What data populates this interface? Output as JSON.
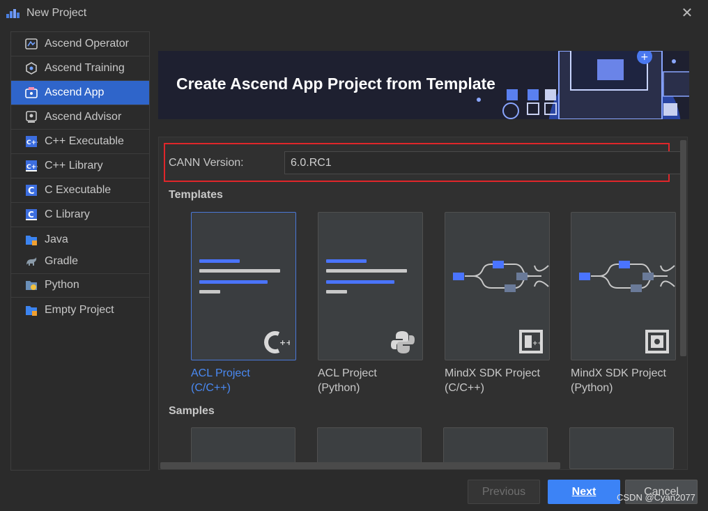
{
  "window": {
    "title": "New Project",
    "close_icon": "close-icon"
  },
  "sidebar": {
    "items": [
      {
        "label": "Ascend Operator",
        "icon": "ascend-operator-icon"
      },
      {
        "label": "Ascend Training",
        "icon": "ascend-training-icon"
      },
      {
        "label": "Ascend App",
        "icon": "ascend-app-icon",
        "active": true
      },
      {
        "label": "Ascend Advisor",
        "icon": "ascend-advisor-icon"
      },
      {
        "label": "C++ Executable",
        "icon": "cpp-executable-icon"
      },
      {
        "label": "C++ Library",
        "icon": "cpp-library-icon"
      },
      {
        "label": "C Executable",
        "icon": "c-executable-icon"
      },
      {
        "label": "C Library",
        "icon": "c-library-icon"
      },
      {
        "label": "Java",
        "icon": "java-folder-icon"
      },
      {
        "label": "Gradle",
        "icon": "gradle-elephant-icon"
      },
      {
        "label": "Python",
        "icon": "python-folder-icon"
      },
      {
        "label": "Empty Project",
        "icon": "empty-project-folder-icon"
      }
    ]
  },
  "banner": {
    "title": "Create Ascend App Project from Template"
  },
  "cann": {
    "label": "CANN Version:",
    "value": "6.0.RC1"
  },
  "templates": {
    "heading": "Templates",
    "items": [
      {
        "label_line1": "ACL Project",
        "label_line2": "(C/C++)",
        "badge": "cpp-logo-icon",
        "selected": true
      },
      {
        "label_line1": "ACL Project",
        "label_line2": "(Python)",
        "badge": "python-logo-icon"
      },
      {
        "label_line1": "MindX SDK Project",
        "label_line2": "(C/C++)",
        "badge": "mindx-cpp-icon"
      },
      {
        "label_line1": "MindX SDK Project",
        "label_line2": "(Python)",
        "badge": "mindx-python-icon"
      }
    ]
  },
  "samples": {
    "heading": "Samples"
  },
  "buttons": {
    "previous": "Previous",
    "next": "Next",
    "cancel": "Cancel"
  },
  "watermark": "CSDN @Cyan2077",
  "colors": {
    "accent": "#2f65ca",
    "next_button": "#3c83f6",
    "highlight_border": "#e0262a",
    "selected_label": "#4a8af4"
  }
}
